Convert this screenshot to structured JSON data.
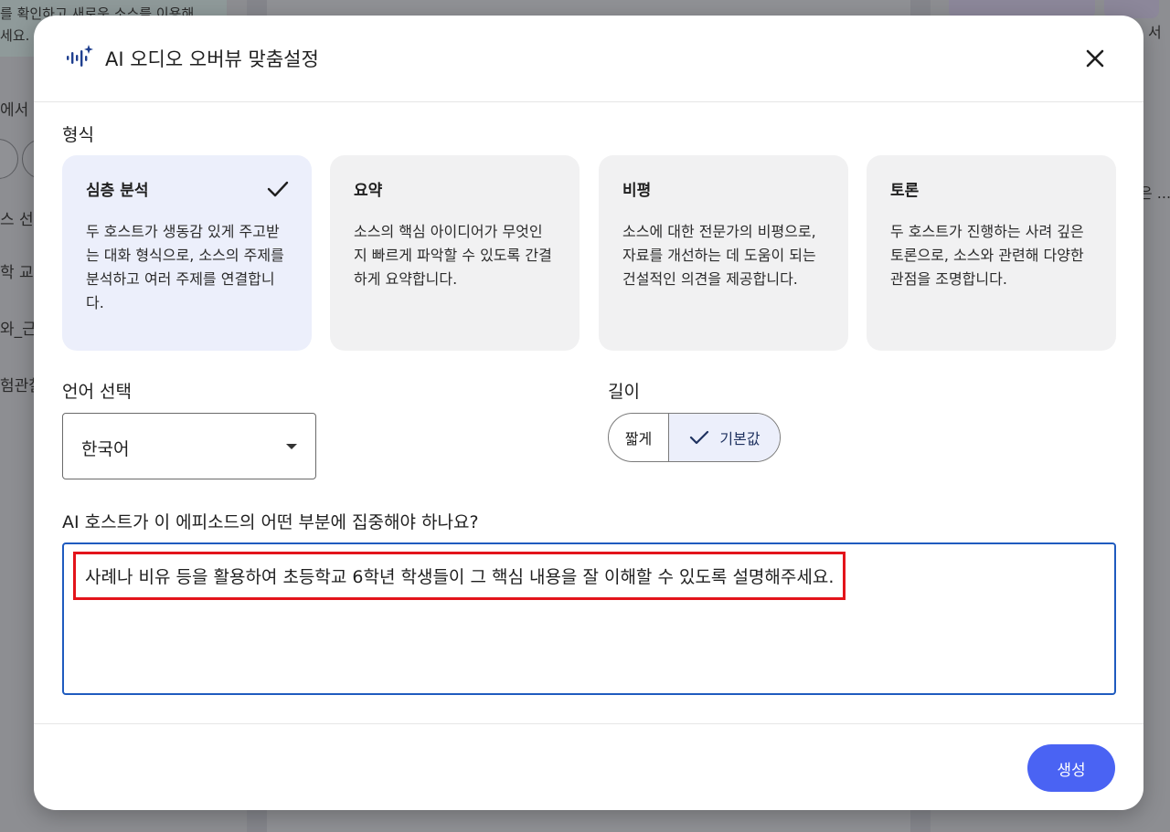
{
  "background": {
    "left_card_lines": [
      "를 확인하고 새로운 소스를 이용해",
      "세요."
    ],
    "left_side_texts": [
      "에서",
      "스 선택",
      "학 교",
      "와_근",
      "험관찰"
    ],
    "right_side_texts": [
      "서",
      "은 ..."
    ]
  },
  "dialog": {
    "title": "AI 오디오 오버뷰 맞춤설정",
    "close_icon": "close-icon",
    "header_icon": "audio-sparkle-icon"
  },
  "format": {
    "label": "형식",
    "cards": [
      {
        "title": "심층 분석",
        "desc": "두 호스트가 생동감 있게 주고받는 대화 형식으로, 소스의 주제를 분석하고 여러 주제를 연결합니다.",
        "selected": true
      },
      {
        "title": "요약",
        "desc": "소스의 핵심 아이디어가 무엇인지 빠르게 파악할 수 있도록 간결하게 요약합니다.",
        "selected": false
      },
      {
        "title": "비평",
        "desc": "소스에 대한 전문가의 비평으로, 자료를 개선하는 데 도움이 되는 건설적인 의견을 제공합니다.",
        "selected": false
      },
      {
        "title": "토론",
        "desc": "두 호스트가 진행하는 사려 깊은 토론으로, 소스와 관련해 다양한 관점을 조명합니다.",
        "selected": false
      }
    ]
  },
  "language": {
    "label": "언어 선택",
    "value": "한국어"
  },
  "length": {
    "label": "길이",
    "options": [
      "짧게",
      "기본값"
    ],
    "selected": "기본값"
  },
  "prompt": {
    "label": "AI 호스트가 이 에피소드의 어떤 부분에 집중해야 하나요?",
    "value": "사례나 비유 등을 활용하여 초등학교 6학년 학생들이 그 핵심 내용을 잘 이해할 수 있도록 설명해주세요."
  },
  "actions": {
    "generate_label": "생성"
  },
  "colors": {
    "accent": "#4a63f3",
    "selected_bg": "#eceffb",
    "highlight_border": "#e3141b",
    "focus_border": "#1f5bbf"
  }
}
